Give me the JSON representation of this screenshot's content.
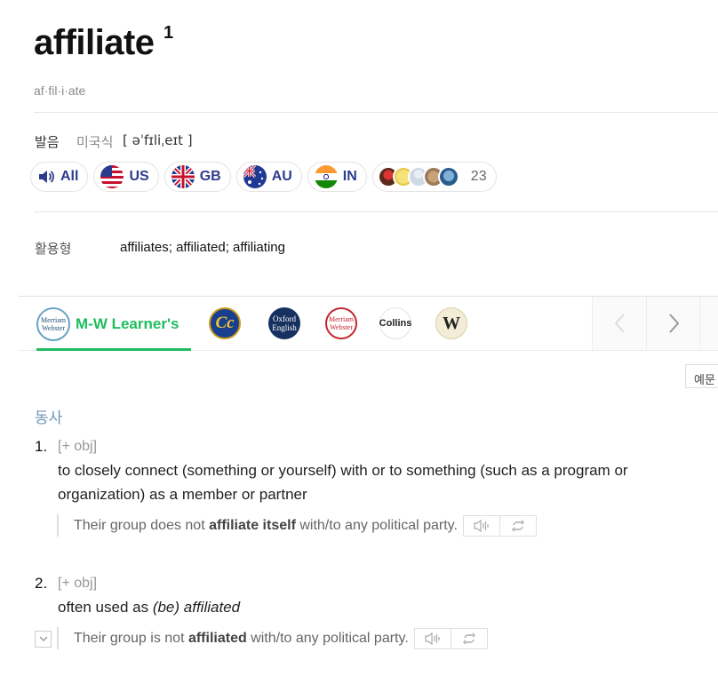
{
  "entry": {
    "headword": "affiliate",
    "superscript": "1",
    "syllables": "af·fil·i·ate"
  },
  "pronunciation": {
    "label": "발음",
    "dialect": "미국식",
    "ipa": "[ əˈfɪliˌeɪt ]",
    "buttons": [
      {
        "label": "All",
        "icon": "speaker-icon"
      },
      {
        "label": "US",
        "icon": "us-flag-icon"
      },
      {
        "label": "GB",
        "icon": "gb-flag-icon"
      },
      {
        "label": "AU",
        "icon": "au-flag-icon"
      },
      {
        "label": "IN",
        "icon": "in-flag-icon"
      }
    ],
    "user_count": "23"
  },
  "inflection": {
    "label": "활용형",
    "value": "affiliates; affiliated; affiliating"
  },
  "dict_tabs": {
    "active_label": "M-W Learner's",
    "icons": [
      "mw-learners-icon",
      "cobuild-icon",
      "oxford-english-icon",
      "merriam-webster-icon",
      "collins-icon",
      "wordnik-icon"
    ],
    "collins_text": "Collins",
    "oxford_text": "Oxford English",
    "mw_text": "Merriam Webster",
    "w_text": "W",
    "cc_text": "Cc"
  },
  "example_toggle": "예문",
  "definitions": {
    "pos": "동사",
    "senses": [
      {
        "num": "1.",
        "gram": "[+ obj]",
        "def": "to closely connect (something or yourself) with or to something (such as a program or organization) as a member or partner",
        "example_pre": "Their group does not ",
        "example_bold": "affiliate itself",
        "example_post": " with/to any political party."
      },
      {
        "num": "2.",
        "gram": "[+ obj]",
        "def_pre": "often used as ",
        "def_italic1": "(be)",
        "def_italic2": "affiliated",
        "example_pre": "Their group is not ",
        "example_bold": "affiliated",
        "example_post": " with/to any political party."
      }
    ]
  },
  "colors": {
    "accent": "#1fbd5e",
    "chip_text": "#2d3c8e",
    "pos": "#6b93b6"
  }
}
